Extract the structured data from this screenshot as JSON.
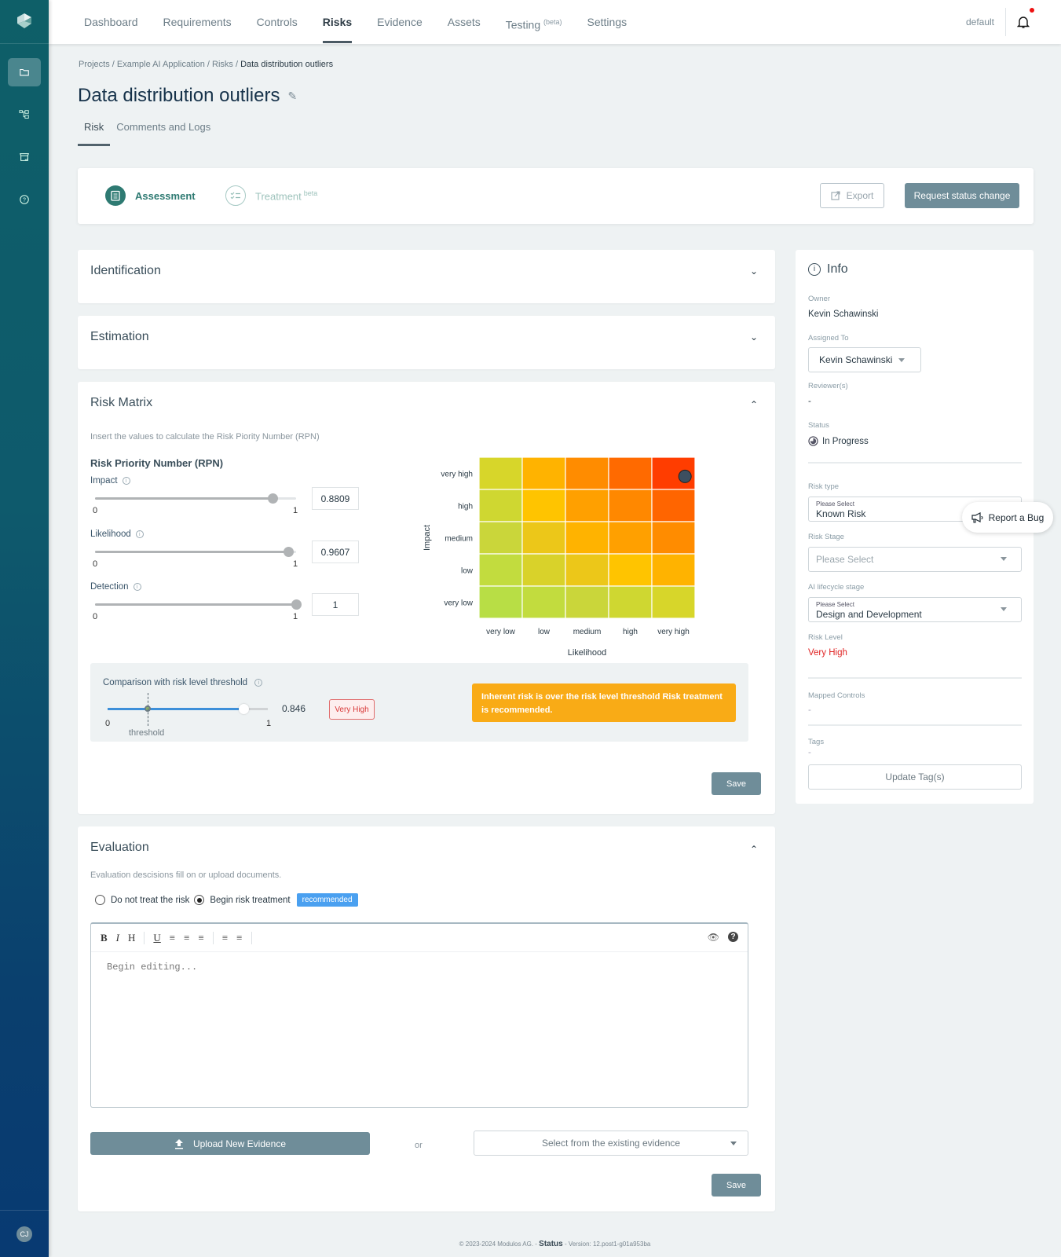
{
  "nav": {
    "items": [
      {
        "label": "Dashboard",
        "active": false
      },
      {
        "label": "Requirements",
        "active": false
      },
      {
        "label": "Controls",
        "active": false
      },
      {
        "label": "Risks",
        "active": true
      },
      {
        "label": "Evidence",
        "active": false
      },
      {
        "label": "Assets",
        "active": false
      },
      {
        "label": "Testing",
        "sup": "(beta)",
        "active": false
      },
      {
        "label": "Settings",
        "active": false
      }
    ],
    "workspace": "default",
    "notification_dot_color": "#ee1111"
  },
  "sidebar": {
    "items": [
      "projects-icon",
      "hierarchy-icon",
      "store-check-icon",
      "help-icon"
    ],
    "user_initials": "CJ"
  },
  "breadcrumb": {
    "parts": [
      "Projects",
      "Example AI Application",
      "Risks"
    ],
    "current": "Data distribution outliers",
    "separator": " / "
  },
  "page": {
    "title": "Data distribution outliers",
    "tabs": [
      "Risk",
      "Comments and Logs"
    ],
    "active_tab": "Risk"
  },
  "steps": {
    "assessment": "Assessment",
    "treatment": "Treatment",
    "treatment_sup": "beta",
    "export_label": "Export",
    "request_label": "Request status change"
  },
  "sections": {
    "identification": "Identification",
    "estimation": "Estimation",
    "risk_matrix": "Risk Matrix",
    "evaluation": "Evaluation"
  },
  "risk_matrix": {
    "subtitle": "Insert the values to calculate the Risk Piority Number (RPN)",
    "rpn_title": "Risk Priority Number (RPN)",
    "sliders": [
      {
        "label": "Impact",
        "value": 0.8809,
        "display": "0.8809",
        "min": "0",
        "max": "1"
      },
      {
        "label": "Likelihood",
        "value": 0.9607,
        "display": "0.9607",
        "min": "0",
        "max": "1"
      },
      {
        "label": "Detection",
        "value": 1,
        "display": "1",
        "min": "0",
        "max": "1"
      }
    ],
    "comparison": {
      "title": "Comparison with risk level threshold",
      "value": 0.846,
      "value_display": "0.846",
      "threshold": 0.25,
      "threshold_label": "threshold",
      "min": "0",
      "max": "1",
      "level_badge": "Very High",
      "alert": "Inherent risk is over the risk level threshold Risk treatment is recommended."
    },
    "save_label": "Save"
  },
  "chart_data": {
    "type": "heatmap",
    "xlabel": "Likelihood",
    "ylabel": "Impact",
    "x_categories": [
      "very low",
      "low",
      "medium",
      "high",
      "very high"
    ],
    "y_categories": [
      "very high",
      "high",
      "medium",
      "low",
      "very low"
    ],
    "cell_colors": [
      [
        "#d7d62a",
        "#ffb300",
        "#ff8c00",
        "#ff6a00",
        "#ff3d00"
      ],
      [
        "#cfd731",
        "#ffc400",
        "#ffa000",
        "#ff8800",
        "#ff6500"
      ],
      [
        "#cad63a",
        "#ecc719",
        "#ffb300",
        "#ffa000",
        "#ff8c00"
      ],
      [
        "#c2dc3e",
        "#d9d22a",
        "#ecc719",
        "#ffc400",
        "#ffb300"
      ],
      [
        "#b8de45",
        "#c2dc3e",
        "#cad63a",
        "#cfd731",
        "#d7d62a"
      ]
    ],
    "marker": {
      "likelihood": 0.9607,
      "impact": 0.8809,
      "color": "#3d4f60"
    }
  },
  "info": {
    "title": "Info",
    "owner_label": "Owner",
    "owner": "Kevin Schawinski",
    "assigned_label": "Assigned To",
    "assigned": "Kevin Schawinski",
    "reviewers_label": "Reviewer(s)",
    "reviewers": "-",
    "status_label": "Status",
    "status": "In Progress",
    "risk_type_label": "Risk type",
    "risk_type_placeholder": "Please Select",
    "risk_type": "Known Risk",
    "risk_stage_label": "Risk Stage",
    "risk_stage_placeholder": "Please Select",
    "lifecycle_label": "AI lifecycle stage",
    "lifecycle_placeholder": "Please Select",
    "lifecycle": "Design and Development",
    "risk_level_label": "Risk Level",
    "risk_level": "Very High",
    "risk_level_color": "#e02424",
    "mapped_controls_label": "Mapped Controls",
    "mapped_controls": "-",
    "tags_label": "Tags",
    "tags": "-",
    "update_tags_label": "Update Tag(s)"
  },
  "report_bug": "Report a Bug",
  "evaluation": {
    "subtitle": "Evaluation descisions fill on or upload documents.",
    "option_no_treat": "Do not treat the risk",
    "option_treat": "Begin risk treatment",
    "selected": "Begin risk treatment",
    "recommended_badge": "recommended",
    "toolbar": [
      "B",
      "I",
      "H",
      "U",
      "align-left",
      "align-center",
      "align-right",
      "ordered-list",
      "bullet-list",
      "preview",
      "help"
    ],
    "editor_placeholder": "Begin editing...",
    "upload_label": "Upload New Evidence",
    "or_label": "or",
    "select_evidence_placeholder": "Select from the existing evidence",
    "save_label": "Save"
  },
  "footer": {
    "copyright": "© 2023-2024 Modulos AG. - ",
    "status": "Status",
    "version": " - Version: 12.post1-g01a953ba"
  }
}
